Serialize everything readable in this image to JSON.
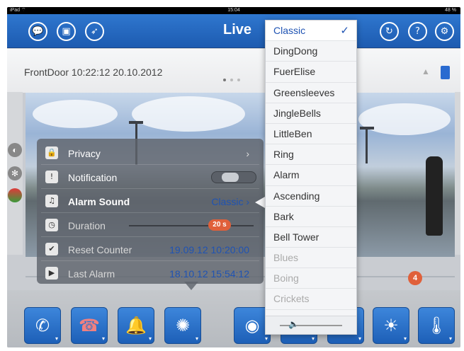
{
  "status": {
    "left": "iPad ⌔",
    "time": "15:04",
    "battery": "48 %"
  },
  "navbar": {
    "title": "Live",
    "left_icons": [
      "chat-icon",
      "window-icon",
      "compass-icon"
    ],
    "right_icons": [
      "refresh-icon",
      "help-icon",
      "settings-icon"
    ],
    "glyphs": {
      "chat": "💬",
      "window": "▣",
      "compass": "➶",
      "refresh": "↻",
      "help": "?",
      "settings": "⚙"
    }
  },
  "subbar": {
    "camera_label": "FrontDoor 10:22:12 20.10.2012"
  },
  "popup": {
    "rows": [
      {
        "icon": "lock-icon",
        "glyph": "🔒",
        "label": "Privacy",
        "value": "›"
      },
      {
        "icon": "exclamation-icon",
        "glyph": "!",
        "label": "Notification",
        "value": ""
      },
      {
        "icon": "music-icon",
        "glyph": "♫",
        "label": "Alarm Sound",
        "value": "Classic ›"
      },
      {
        "icon": "clock-icon",
        "glyph": "◷",
        "label": "Duration",
        "value": "20 s"
      },
      {
        "icon": "check-icon",
        "glyph": "✔",
        "label": "Reset Counter",
        "value": "19.09.12 10:20:00"
      },
      {
        "icon": "play-icon",
        "glyph": "▶",
        "label": "Last Alarm",
        "value": "18.10.12 15:54:12"
      }
    ],
    "notification_on": true
  },
  "dropdown": {
    "items": [
      "Classic",
      "DingDong",
      "FuerElise",
      "Greensleeves",
      "JingleBells",
      "LittleBen",
      "Ring",
      "Alarm",
      "Ascending",
      "Bark",
      "Bell Tower",
      "Blues",
      "Boing",
      "Crickets"
    ],
    "selected": "Classic",
    "check": "✓",
    "volume_icon": "🔈"
  },
  "event_badge": "4",
  "toolbar": {
    "buttons": [
      {
        "icon": "phone-icon",
        "glyph": "✆"
      },
      {
        "icon": "hangup-icon",
        "glyph": "☎"
      },
      {
        "icon": "bell-icon",
        "glyph": "🔔"
      },
      {
        "icon": "siren-icon",
        "glyph": "✺"
      },
      {
        "icon": "fisheye-camera-icon",
        "glyph": "◉"
      },
      {
        "icon": "button-icon",
        "glyph": "▭"
      },
      {
        "icon": "door-icon",
        "glyph": "▯"
      },
      {
        "icon": "light-icon",
        "glyph": "☀"
      },
      {
        "icon": "thermometer-icon",
        "glyph": "🌡"
      }
    ]
  },
  "colors": {
    "accent": "#1f53b3",
    "navbar": "#2a6bd0",
    "badge": "#e0603a"
  }
}
